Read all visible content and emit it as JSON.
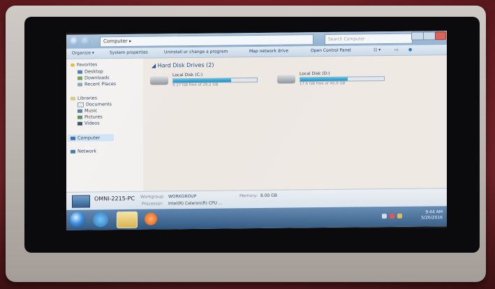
{
  "window": {
    "breadcrumb": "Computer ▸",
    "search_placeholder": "Search Computer"
  },
  "toolbar": {
    "organize": "Organize ▾",
    "system_properties": "System properties",
    "uninstall": "Uninstall or change a program",
    "map_drive": "Map network drive",
    "control_panel": "Open Control Panel"
  },
  "sidebar": {
    "favorites": "Favorites",
    "desktop": "Desktop",
    "downloads": "Downloads",
    "recent": "Recent Places",
    "libraries": "Libraries",
    "documents": "Documents",
    "music": "Music",
    "pictures": "Pictures",
    "videos": "Videos",
    "computer": "Computer",
    "network": "Network"
  },
  "content": {
    "group_title": "Hard Disk Drives (2)",
    "drives": [
      {
        "name": "Local Disk (C:)",
        "free_text": "9.17 GB free of 29.2 GB",
        "used_fraction": 0.69
      },
      {
        "name": "Local Disk (D:)",
        "free_text": "17.6 GB free of 40.9 GB",
        "used_fraction": 0.57
      }
    ]
  },
  "details": {
    "pc_name": "OMNI-2215-PC",
    "workgroup_label": "Workgroup:",
    "workgroup_value": "WORKGROUP",
    "memory_label": "Memory:",
    "memory_value": "8.00 GB",
    "processor_label": "Processor:",
    "processor_value": "Intel(R) Celeron(R) CPU ..."
  },
  "taskbar": {
    "time": "9:44 AM",
    "date": "5/26/2016"
  },
  "colors": {
    "accent": "#1c8cc4",
    "taskbar": "#2f5780",
    "backdrop": "#7a1e24"
  }
}
